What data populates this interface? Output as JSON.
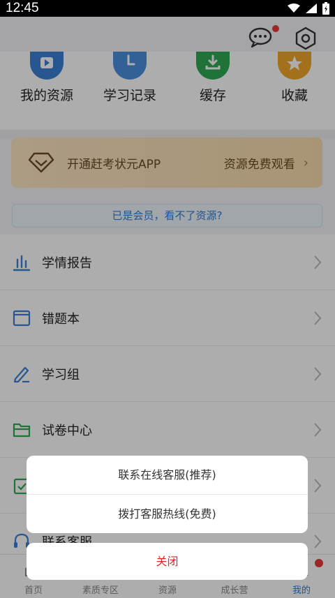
{
  "status_bar": {
    "time": "12:45"
  },
  "quick_actions": [
    {
      "label": "我的资源",
      "icon": "play-icon",
      "color": "#3b7fd4"
    },
    {
      "label": "学习记录",
      "icon": "clock-icon",
      "color": "#4a8fe0"
    },
    {
      "label": "缓存",
      "icon": "download-icon",
      "color": "#2eaa55"
    },
    {
      "label": "收藏",
      "icon": "star-icon",
      "color": "#f0a628"
    }
  ],
  "promo": {
    "text": "开通赶考状元APP",
    "sub": "资源免费观看",
    "chevron": "›"
  },
  "member_link": "已是会员，看不了资源?",
  "menu": [
    {
      "label": "学情报告",
      "icon": "bar-chart-icon",
      "color": "#3b7fd4"
    },
    {
      "label": "错题本",
      "icon": "notebook-icon",
      "color": "#3b7fd4"
    },
    {
      "label": "学习组",
      "icon": "pencil-icon",
      "color": "#3b7fd4"
    },
    {
      "label": "试卷中心",
      "icon": "folder-icon",
      "color": "#2eaa55"
    },
    {
      "label": "",
      "icon": "clipboard-check-icon",
      "color": "#2eaa55"
    },
    {
      "label": "联系客服",
      "icon": "headset-icon",
      "color": "#3b7fd4"
    }
  ],
  "tabs": [
    {
      "label": "首页",
      "icon": "home-icon"
    },
    {
      "label": "素质专区",
      "icon": "quality-icon"
    },
    {
      "label": "资源",
      "icon": "resource-icon"
    },
    {
      "label": "成长营",
      "icon": "growth-icon"
    },
    {
      "label": "我的",
      "icon": "profile-icon",
      "active": true
    }
  ],
  "sheet": {
    "options": [
      "联系在线客服(推荐)",
      "拨打客服热线(免费)"
    ],
    "cancel": "关闭"
  },
  "colors": {
    "accent": "#2f7dd6",
    "danger": "#e02424",
    "badge": "#e53935"
  }
}
